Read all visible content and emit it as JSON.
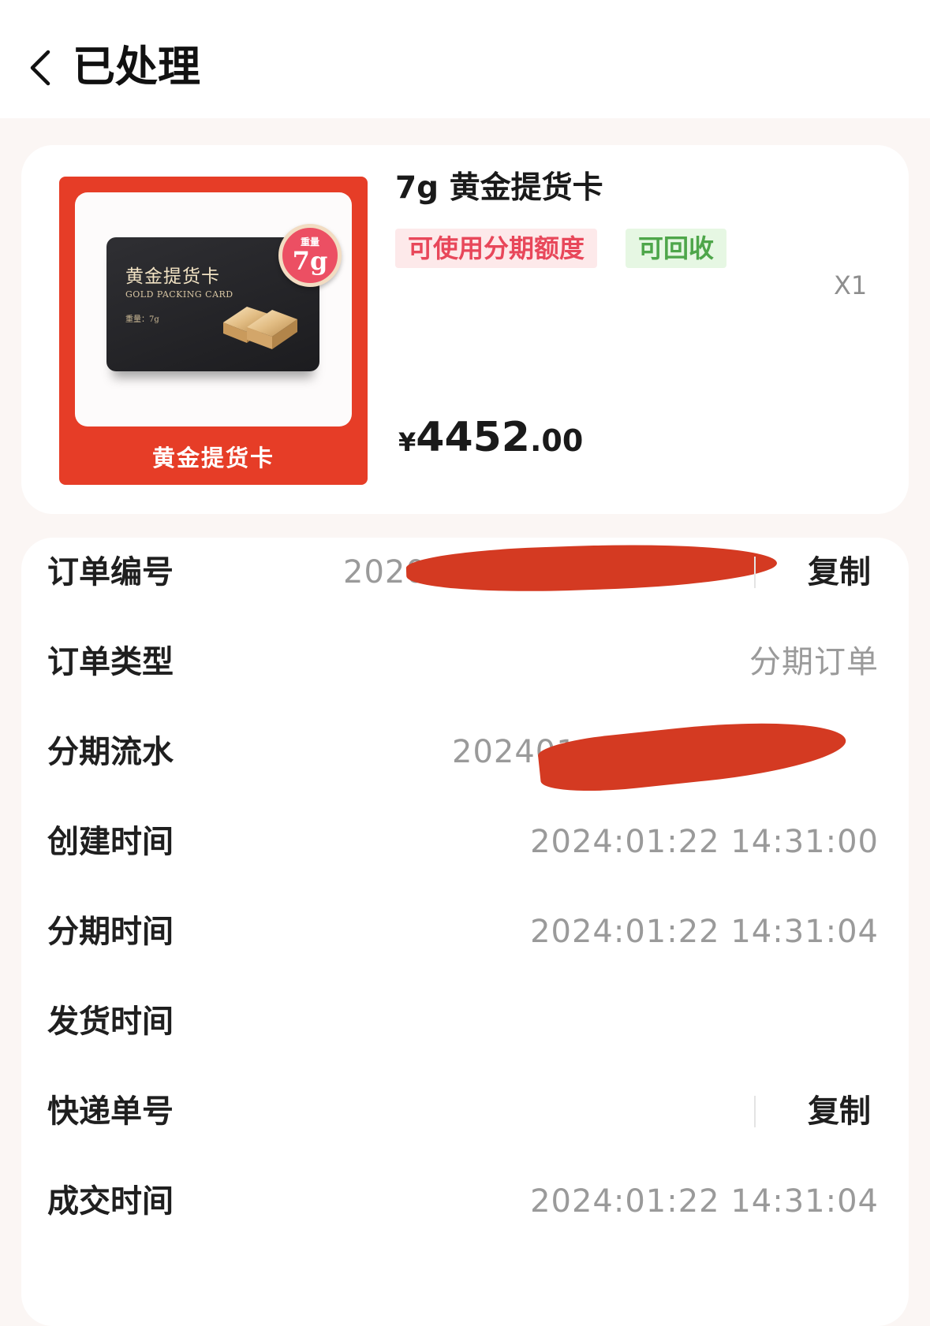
{
  "header": {
    "title": "已处理"
  },
  "product": {
    "name": "7g 黄金提货卡",
    "image": {
      "card_title": "黄金提货卡",
      "card_subtitle": "GOLD PACKING CARD",
      "card_weight": "重量：7g",
      "badge_top": "重量",
      "badge_value": "7g",
      "caption": "黄金提货卡"
    },
    "tags": [
      "可使用分期额度",
      "可回收"
    ],
    "quantity": "X1",
    "price": {
      "symbol": "¥",
      "integer": "4452",
      "decimal": ".00"
    }
  },
  "info": {
    "rows": [
      {
        "label": "订单编号",
        "value": "2020",
        "copy": "复制"
      },
      {
        "label": "订单类型",
        "value": "分期订单"
      },
      {
        "label": "分期流水",
        "value": "2024010"
      },
      {
        "label": "创建时间",
        "value": "2024:01:22 14:31:00"
      },
      {
        "label": "分期时间",
        "value": "2024:01:22 14:31:04"
      },
      {
        "label": "发货时间",
        "value": ""
      },
      {
        "label": "快递单号",
        "value": "",
        "copy": "复制"
      },
      {
        "label": "成交时间",
        "value": "2024:01:22 14:31:04"
      }
    ]
  },
  "colors": {
    "accent_red": "#e63d27",
    "tag_red": "#e8475a",
    "tag_green": "#4ea64a",
    "redaction": "#d43a22"
  }
}
